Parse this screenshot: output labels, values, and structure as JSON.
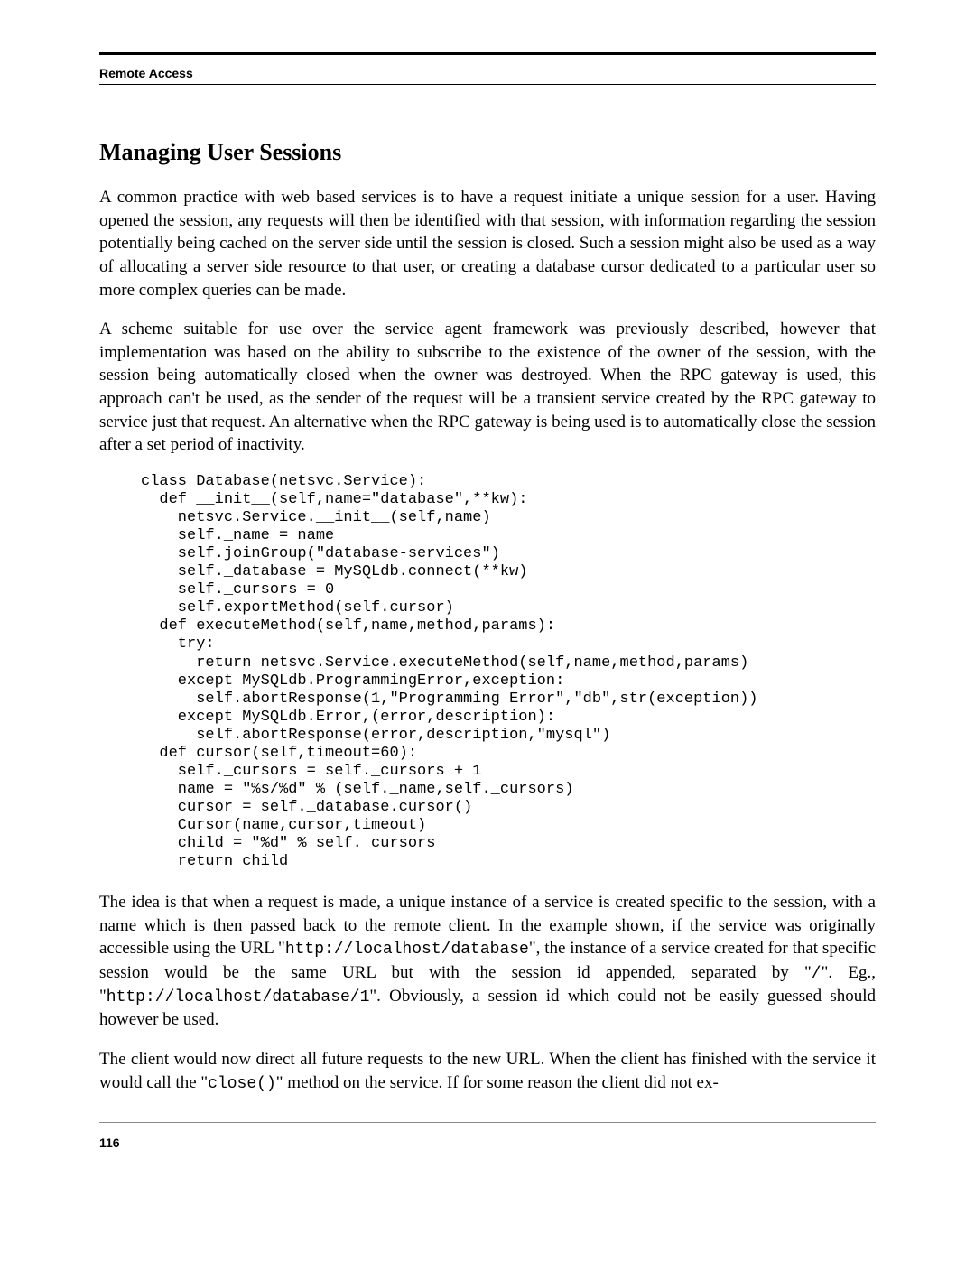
{
  "header": {
    "chapter": "Remote Access"
  },
  "section": {
    "title": "Managing User Sessions"
  },
  "paragraphs": {
    "p1": "A common practice with web based services is to have a request initiate a unique session for a user. Having opened the session, any requests will then be identified with that session, with information regarding the session potentially being cached on the server side until the session is closed. Such a session might also be used as a way of allocating a server side resource to that user, or creating a database cursor dedicated to a particular user so more complex queries can be made.",
    "p2": "A scheme suitable for use over the service agent framework was previously described, however that implementation was based on the ability to subscribe to the existence of the owner of the session, with the session being automatically closed when the owner was destroyed. When the RPC gateway is used, this approach can't be used, as the sender of the request will be a transient service created by the RPC gateway to service just that request. An alternative when the RPC gateway is being used is to automatically close the session after a set period of inactivity.",
    "p3_a": "The idea is that when a request is made, a unique instance of a service is created specific to the session, with a name which is then passed back to the remote client. In the example shown, if the service was originally accessible using the URL \"",
    "p3_code1": "http://localhost/database",
    "p3_b": "\", the instance of a service created for that specific session would be the same URL but with the session id appended, separated by \"",
    "p3_code2": "/",
    "p3_c": "\". Eg., \"",
    "p3_code3": "http://localhost/database/1",
    "p3_d": "\". Obviously, a session id which could not be easily guessed should however be used.",
    "p4_a": "The client would now direct all future requests to the new URL. When the client has finished with the service it would call the \"",
    "p4_code1": "close()",
    "p4_b": "\" method on the service. If for some reason the client did not ex-"
  },
  "code_block": "class Database(netsvc.Service):\n  def __init__(self,name=\"database\",**kw):\n    netsvc.Service.__init__(self,name)\n    self._name = name\n    self.joinGroup(\"database-services\")\n    self._database = MySQLdb.connect(**kw)\n    self._cursors = 0\n    self.exportMethod(self.cursor)\n  def executeMethod(self,name,method,params):\n    try:\n      return netsvc.Service.executeMethod(self,name,method,params)\n    except MySQLdb.ProgrammingError,exception:\n      self.abortResponse(1,\"Programming Error\",\"db\",str(exception))\n    except MySQLdb.Error,(error,description):\n      self.abortResponse(error,description,\"mysql\")\n  def cursor(self,timeout=60):\n    self._cursors = self._cursors + 1\n    name = \"%s/%d\" % (self._name,self._cursors)\n    cursor = self._database.cursor()\n    Cursor(name,cursor,timeout)\n    child = \"%d\" % self._cursors\n    return child",
  "footer": {
    "page_number": "116"
  }
}
